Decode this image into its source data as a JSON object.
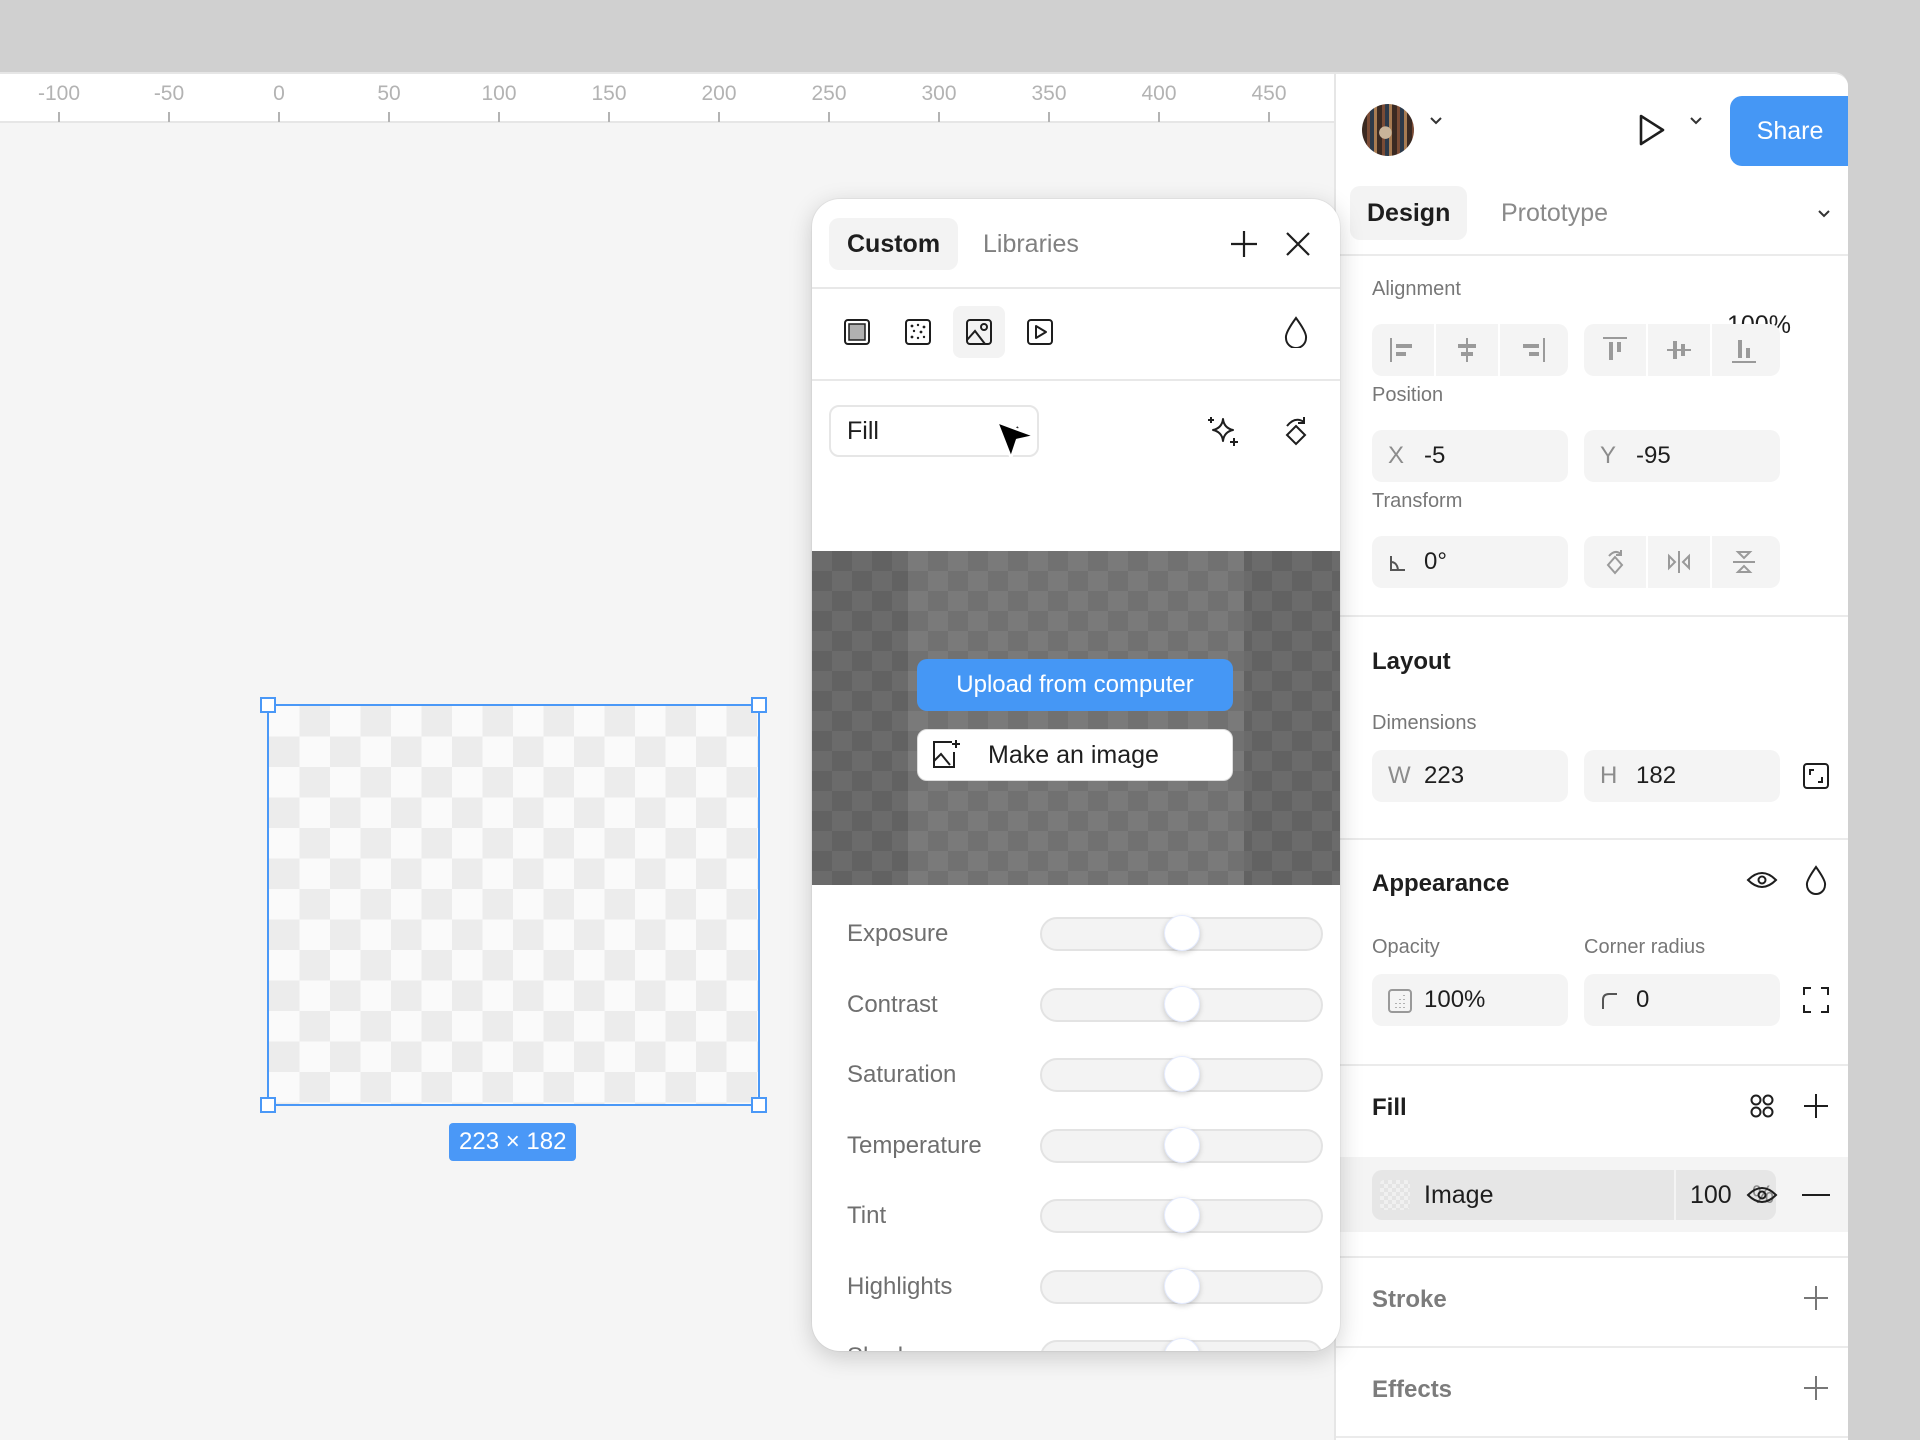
{
  "ruler": {
    "ticks": [
      "-100",
      "-50",
      "0",
      "50",
      "100",
      "150",
      "200",
      "250",
      "300",
      "350",
      "400",
      "450"
    ]
  },
  "canvas": {
    "selection_size_label": "223 × 182",
    "selection_color": "#4a98f7"
  },
  "header": {
    "avatar_icon": "user-avatar",
    "play_icon": "play-icon",
    "share_label": "Share",
    "accent_color": "#4597f5"
  },
  "tabs": {
    "design": "Design",
    "prototype": "Prototype",
    "zoom": "100%"
  },
  "design_panel": {
    "alignment_label": "Alignment",
    "alignment_buttons": [
      "align-left",
      "align-horizontal-center",
      "align-right",
      "align-top",
      "align-vertical-center",
      "align-bottom"
    ],
    "position_label": "Position",
    "x_prefix": "X",
    "x_value": "-5",
    "y_prefix": "Y",
    "y_value": "-95",
    "transform_label": "Transform",
    "rotation_value": "0°",
    "transform_buttons": [
      "rotate-90",
      "flip-horizontal",
      "flip-vertical"
    ],
    "layout_title": "Layout",
    "dimensions_label": "Dimensions",
    "w_prefix": "W",
    "w_value": "223",
    "h_prefix": "H",
    "h_value": "182",
    "appearance_title": "Appearance",
    "opacity_label": "Opacity",
    "opacity_value": "100%",
    "corner_radius_label": "Corner radius",
    "corner_radius_value": "0",
    "fill_title": "Fill",
    "fill_items": [
      {
        "type": "Image",
        "opacity": "100",
        "unit": "%"
      }
    ],
    "stroke_title": "Stroke",
    "effects_title": "Effects"
  },
  "fill_picker": {
    "tabs": [
      "Custom",
      "Libraries"
    ],
    "active_tab": "Custom",
    "fill_types": [
      "solid",
      "gradient",
      "image",
      "video"
    ],
    "selected_fill_type": "image",
    "mode_select": "Fill",
    "upload_label": "Upload from computer",
    "make_image_label": "Make an image",
    "adjustments": [
      {
        "label": "Exposure",
        "value": 0.5
      },
      {
        "label": "Contrast",
        "value": 0.5
      },
      {
        "label": "Saturation",
        "value": 0.5
      },
      {
        "label": "Temperature",
        "value": 0.5
      },
      {
        "label": "Tint",
        "value": 0.5
      },
      {
        "label": "Highlights",
        "value": 0.5
      },
      {
        "label": "Shadows",
        "value": 0.5
      }
    ]
  }
}
